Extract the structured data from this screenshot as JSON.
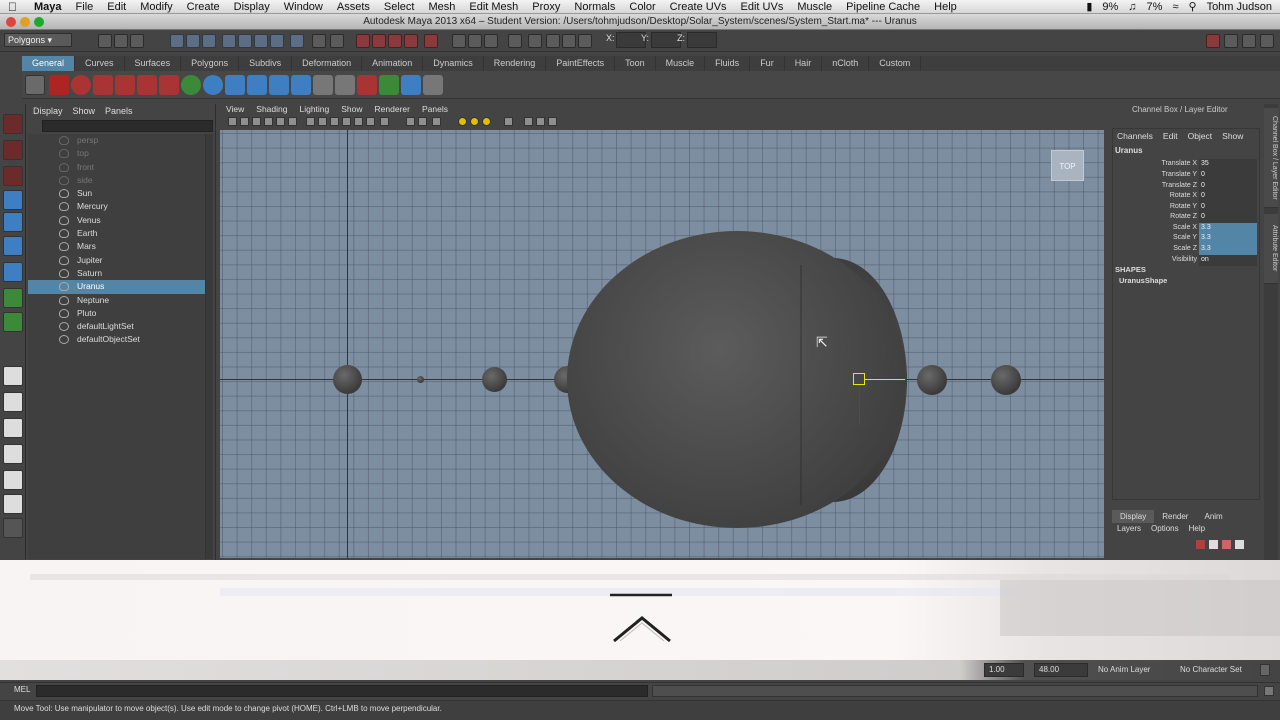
{
  "menubar": {
    "items": [
      "Maya",
      "File",
      "Edit",
      "Modify",
      "Create",
      "Display",
      "Window",
      "Assets",
      "Select",
      "Mesh",
      "Edit Mesh",
      "Proxy",
      "Normals",
      "Color",
      "Create UVs",
      "Edit UVs",
      "Muscle",
      "Pipeline Cache",
      "Help"
    ],
    "battery": "9%",
    "volume": "7%",
    "user": "Tohm Judson"
  },
  "window": {
    "title": "Autodesk Maya 2013 x64 – Student Version: /Users/tohmjudson/Desktop/Solar_System/scenes/System_Start.ma*   ---   Uranus"
  },
  "statusline": {
    "mode": "Polygons",
    "x_label": "X:",
    "y_label": "Y:",
    "z_label": "Z:"
  },
  "shelf": {
    "tabs": [
      "General",
      "Curves",
      "Surfaces",
      "Polygons",
      "Subdivs",
      "Deformation",
      "Animation",
      "Dynamics",
      "Rendering",
      "PaintEffects",
      "Toon",
      "Muscle",
      "Fluids",
      "Fur",
      "Hair",
      "nCloth",
      "Custom"
    ],
    "active_tab": "General"
  },
  "outliner": {
    "menu": [
      "Display",
      "Show",
      "Panels"
    ],
    "items": [
      {
        "label": "persp",
        "dim": true
      },
      {
        "label": "top",
        "dim": true
      },
      {
        "label": "front",
        "dim": true
      },
      {
        "label": "side",
        "dim": true
      },
      {
        "label": "Sun",
        "dim": false
      },
      {
        "label": "Mercury",
        "dim": false
      },
      {
        "label": "Venus",
        "dim": false
      },
      {
        "label": "Earth",
        "dim": false
      },
      {
        "label": "Mars",
        "dim": false
      },
      {
        "label": "Jupiter",
        "dim": false
      },
      {
        "label": "Saturn",
        "dim": false
      },
      {
        "label": "Uranus",
        "dim": false,
        "selected": true
      },
      {
        "label": "Neptune",
        "dim": false
      },
      {
        "label": "Pluto",
        "dim": false
      },
      {
        "label": "defaultLightSet",
        "dim": false
      },
      {
        "label": "defaultObjectSet",
        "dim": false
      }
    ]
  },
  "viewport": {
    "menu": [
      "View",
      "Shading",
      "Lighting",
      "Show",
      "Renderer",
      "Panels"
    ],
    "camera_label": "TOP"
  },
  "channelbox": {
    "header": "Channel Box / Layer Editor",
    "menu": [
      "Channels",
      "Edit",
      "Object",
      "Show"
    ],
    "object": "Uranus",
    "attributes": [
      {
        "label": "Translate X",
        "value": "35"
      },
      {
        "label": "Translate Y",
        "value": "0"
      },
      {
        "label": "Translate Z",
        "value": "0"
      },
      {
        "label": "Rotate X",
        "value": "0"
      },
      {
        "label": "Rotate Y",
        "value": "0"
      },
      {
        "label": "Rotate Z",
        "value": "0"
      },
      {
        "label": "Scale X",
        "value": "3.3",
        "highlight": true
      },
      {
        "label": "Scale Y",
        "value": "3.3",
        "highlight": true
      },
      {
        "label": "Scale Z",
        "value": "3.3",
        "highlight": true
      },
      {
        "label": "Visibility",
        "value": "on"
      }
    ],
    "shapes_label": "SHAPES",
    "shape_name": "UranusShape"
  },
  "sidetabs": [
    "Channel Box / Layer Editor",
    "Attribute Editor"
  ],
  "layer_editor": {
    "tabs": [
      "Display",
      "Render",
      "Anim"
    ],
    "menu": [
      "Layers",
      "Options",
      "Help"
    ]
  },
  "rangebar": {
    "start": "1.00",
    "end": "48.00",
    "anim_layer": "No Anim Layer",
    "char_set": "No Character Set"
  },
  "cmdline": {
    "label": "MEL"
  },
  "helpline": {
    "text": "Move Tool: Use manipulator to move object(s). Use edit mode to change pivot (HOME). Ctrl+LMB to move perpendicular."
  },
  "colors": {
    "selection": "#5285a6",
    "viewport_bg": "#7d8ea1",
    "panel": "#444444"
  }
}
